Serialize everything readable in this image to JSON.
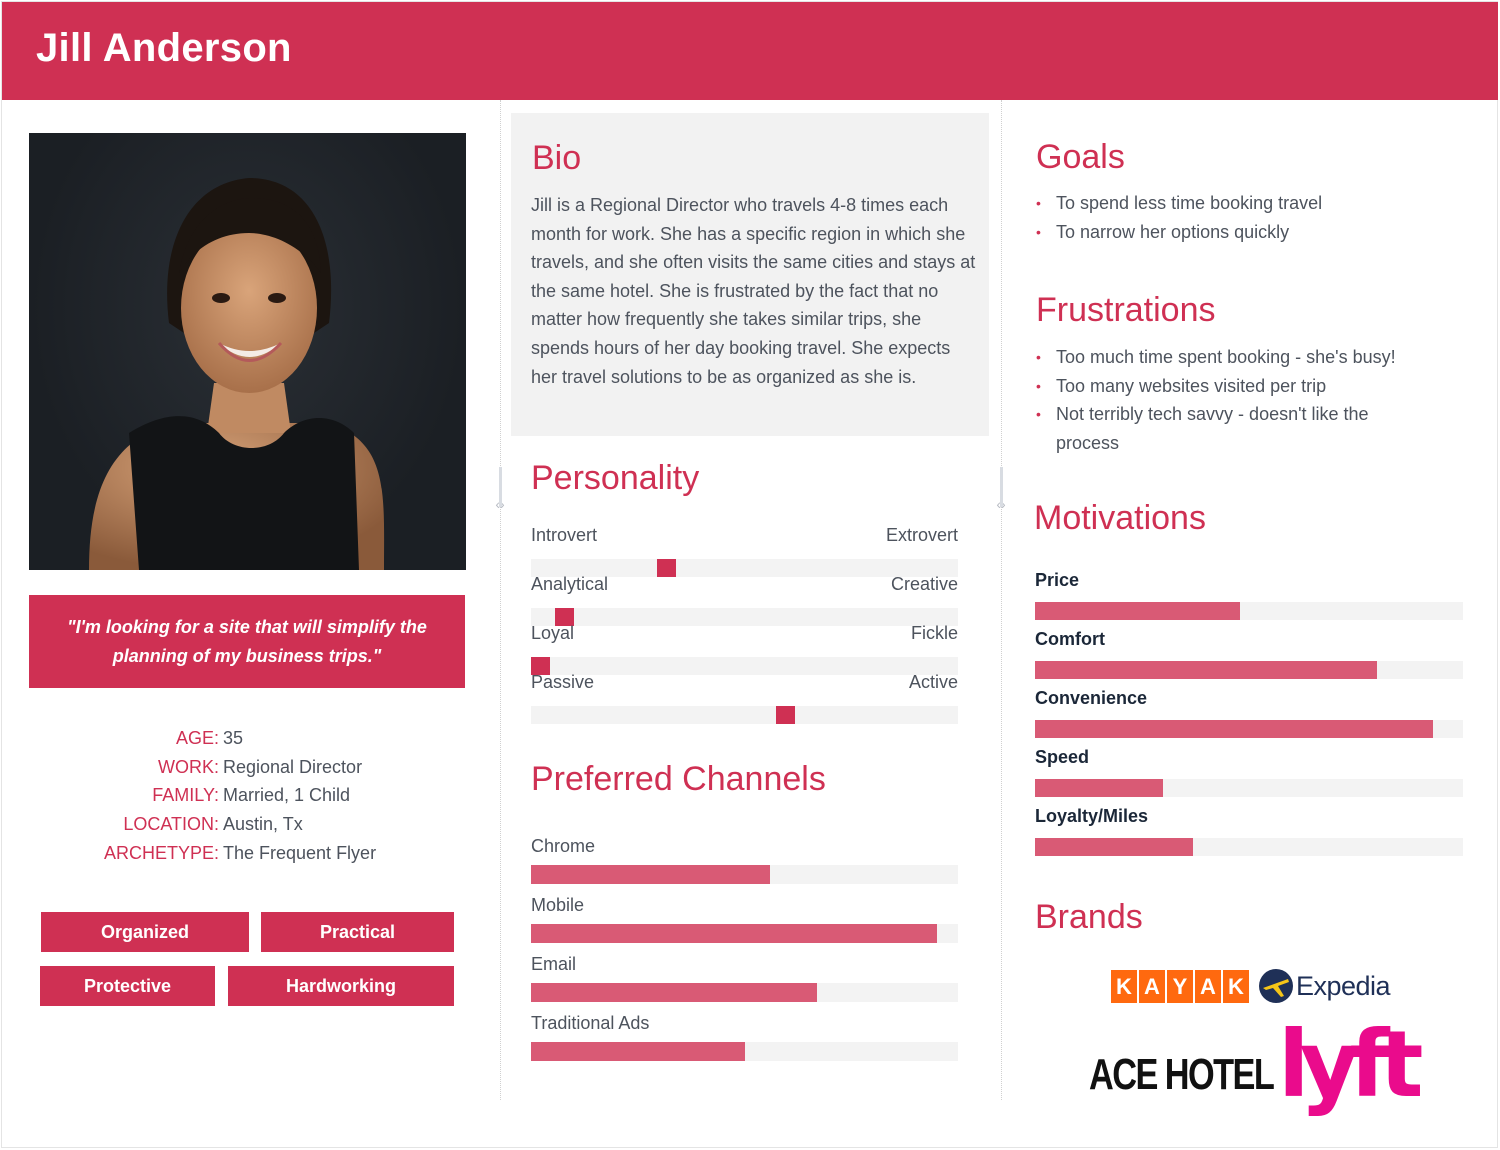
{
  "persona": {
    "name": "Jill Anderson",
    "quote": "\"I'm looking for a site that will simplify the planning of my business trips.\"",
    "photo_alt": "Portrait of Jill Anderson",
    "facts": [
      {
        "key": "AGE:",
        "value": "35"
      },
      {
        "key": "WORK:",
        "value": "Regional Director"
      },
      {
        "key": "FAMILY:",
        "value": "Married, 1 Child"
      },
      {
        "key": "LOCATION:",
        "value": "Austin, Tx"
      },
      {
        "key": "ARCHETYPE:",
        "value": "The Frequent Flyer"
      }
    ],
    "tags": [
      "Organized",
      "Practical",
      "Protective",
      "Hardworking"
    ]
  },
  "bio": {
    "title": "Bio",
    "text": "Jill is a Regional Director who travels 4-8 times each month for work. She has a specific region in which she travels, and she often visits the same cities and stays at the same hotel. She is frustrated by the fact that no matter how frequently she takes similar trips, she spends hours of her day booking travel. She expects her travel solutions to be as organized as she is."
  },
  "personality": {
    "title": "Personality",
    "traits": [
      {
        "left": "Introvert",
        "right": "Extrovert",
        "position": 0.31
      },
      {
        "left": "Analytical",
        "right": "Creative",
        "position": 0.06
      },
      {
        "left": "Loyal",
        "right": "Fickle",
        "position": 0.0
      },
      {
        "left": "Passive",
        "right": "Active",
        "position": 0.6
      }
    ]
  },
  "channels": {
    "title": "Preferred Channels",
    "items": [
      {
        "label": "Chrome",
        "percent": 56
      },
      {
        "label": "Mobile",
        "percent": 95
      },
      {
        "label": "Email",
        "percent": 67
      },
      {
        "label": "Traditional Ads",
        "percent": 50
      }
    ]
  },
  "goals": {
    "title": "Goals",
    "items": [
      "To spend less time booking travel",
      "To narrow her options quickly"
    ]
  },
  "frustrations": {
    "title": "Frustrations",
    "items": [
      "Too much time spent booking - she's busy!",
      "Too many websites visited per trip",
      "Not terribly tech savvy - doesn't like the process"
    ]
  },
  "motivations": {
    "title": "Motivations",
    "items": [
      {
        "label": "Price",
        "percent": 48
      },
      {
        "label": "Comfort",
        "percent": 80
      },
      {
        "label": "Convenience",
        "percent": 93
      },
      {
        "label": "Speed",
        "percent": 30
      },
      {
        "label": "Loyalty/Miles",
        "percent": 37
      }
    ]
  },
  "brands": {
    "title": "Brands",
    "logos": {
      "kayak": "KAYAK",
      "expedia": "Expedia",
      "ace_hotel": "ACE HOTEL",
      "lyft": "lyft"
    }
  },
  "colors": {
    "accent": "#cf3053",
    "bar_fill": "#d95a75",
    "track": "#f3f3f3",
    "text": "#4d535d",
    "kayak": "#ff690f",
    "expedia_navy": "#1f3057",
    "lyft": "#ea0b8c"
  }
}
